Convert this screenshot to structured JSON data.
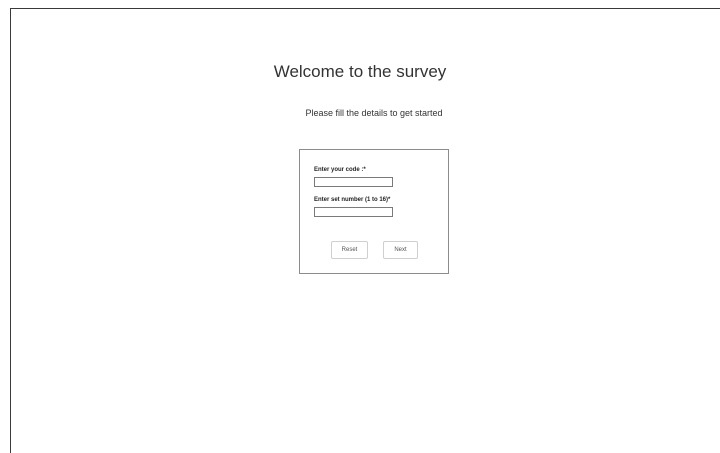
{
  "page": {
    "title": "Welcome to the survey",
    "subtitle": "Please fill the details to get started"
  },
  "form": {
    "code_label": "Enter your code :*",
    "code_value": "",
    "set_label": "Enter set number (1 to 16)*",
    "set_value": "",
    "reset_label": "Reset",
    "next_label": "Next"
  }
}
